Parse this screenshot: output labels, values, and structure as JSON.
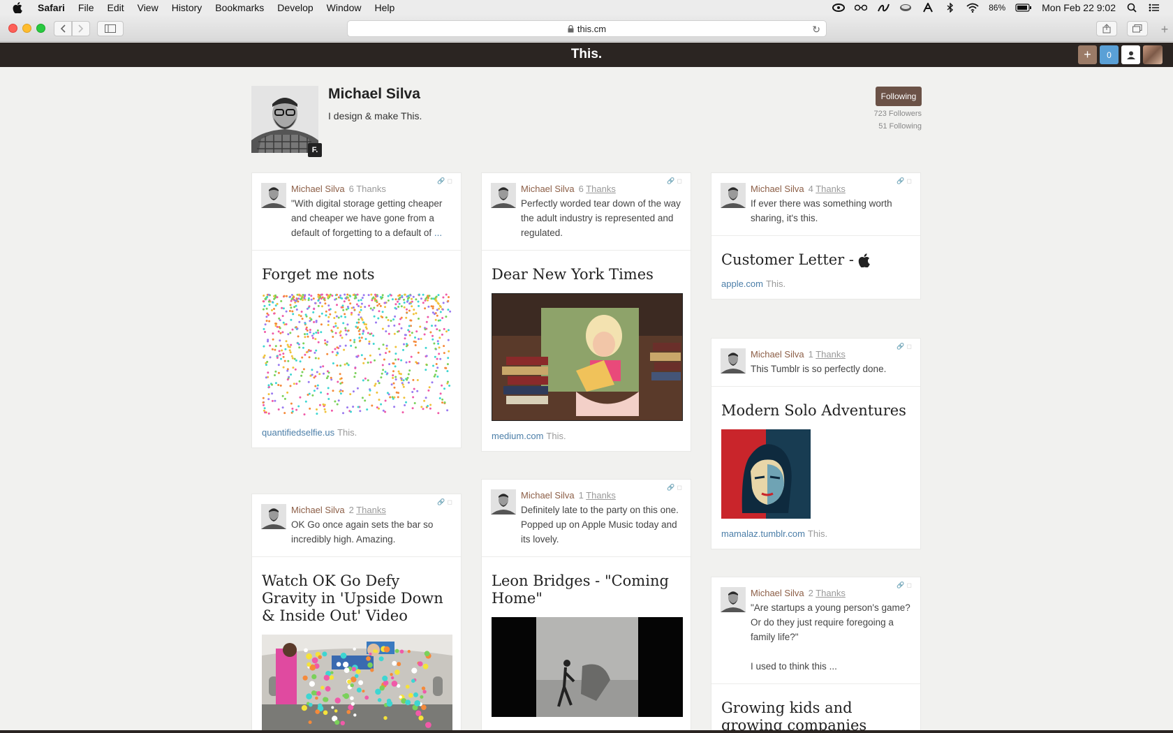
{
  "menubar": {
    "app": "Safari",
    "items": [
      "File",
      "Edit",
      "View",
      "History",
      "Bookmarks",
      "Develop",
      "Window",
      "Help"
    ],
    "battery": "86%",
    "datetime": "Mon Feb 22  9:02"
  },
  "browser": {
    "url": "this.cm"
  },
  "site": {
    "logo": "This.",
    "counter": "0"
  },
  "profile": {
    "name": "Michael Silva",
    "bio": "I design & make This.",
    "badge": "F.",
    "follow_label": "Following",
    "followers": "723 Followers",
    "following": "51 Following"
  },
  "cards": [
    {
      "author": "Michael Silva",
      "thanks_n": "6",
      "thanks_label": "Thanks",
      "text": "\"With digital storage getting cheaper and cheaper we have gone from a default of forgetting to a default of",
      "more": "...",
      "title": "Forget me nots",
      "domain": "quantifiedselfie.us",
      "this": "This."
    },
    {
      "author": "Michael Silva",
      "thanks_n": "6",
      "thanks_label": "Thanks",
      "text": "Perfectly worded tear down of the way the adult industry is represented and regulated.",
      "title": "Dear New York Times",
      "domain": "medium.com",
      "this": "This."
    },
    {
      "author": "Michael Silva",
      "thanks_n": "4",
      "thanks_label": "Thanks",
      "text": "If ever there was something worth sharing, it's this.",
      "title": "Customer Letter - ",
      "domain": "apple.com",
      "this": "This."
    },
    {
      "author": "Michael Silva",
      "thanks_n": "1",
      "thanks_label": "Thanks",
      "text": "This Tumblr is so perfectly done.",
      "title": "Modern Solo Adventures",
      "domain": "mamalaz.tumblr.com",
      "this": "This."
    },
    {
      "author": "Michael Silva",
      "thanks_n": "2",
      "thanks_label": "Thanks",
      "text": "OK Go once again sets the bar so incredibly high. Amazing.",
      "title": "Watch OK Go Defy Gravity in 'Upside Down & Inside Out' Video"
    },
    {
      "author": "Michael Silva",
      "thanks_n": "1",
      "thanks_label": "Thanks",
      "text": "Definitely late to the party on this one. Popped up on Apple Music today and its lovely.",
      "title": "Leon Bridges - \"Coming Home\""
    },
    {
      "author": "Michael Silva",
      "thanks_n": "2",
      "thanks_label": "Thanks",
      "text": "\"Are startups a young person's game? Or do they just require foregoing a family life?\"\n\nI used to think this",
      "more": "...",
      "title": "Growing kids and growing companies"
    }
  ]
}
